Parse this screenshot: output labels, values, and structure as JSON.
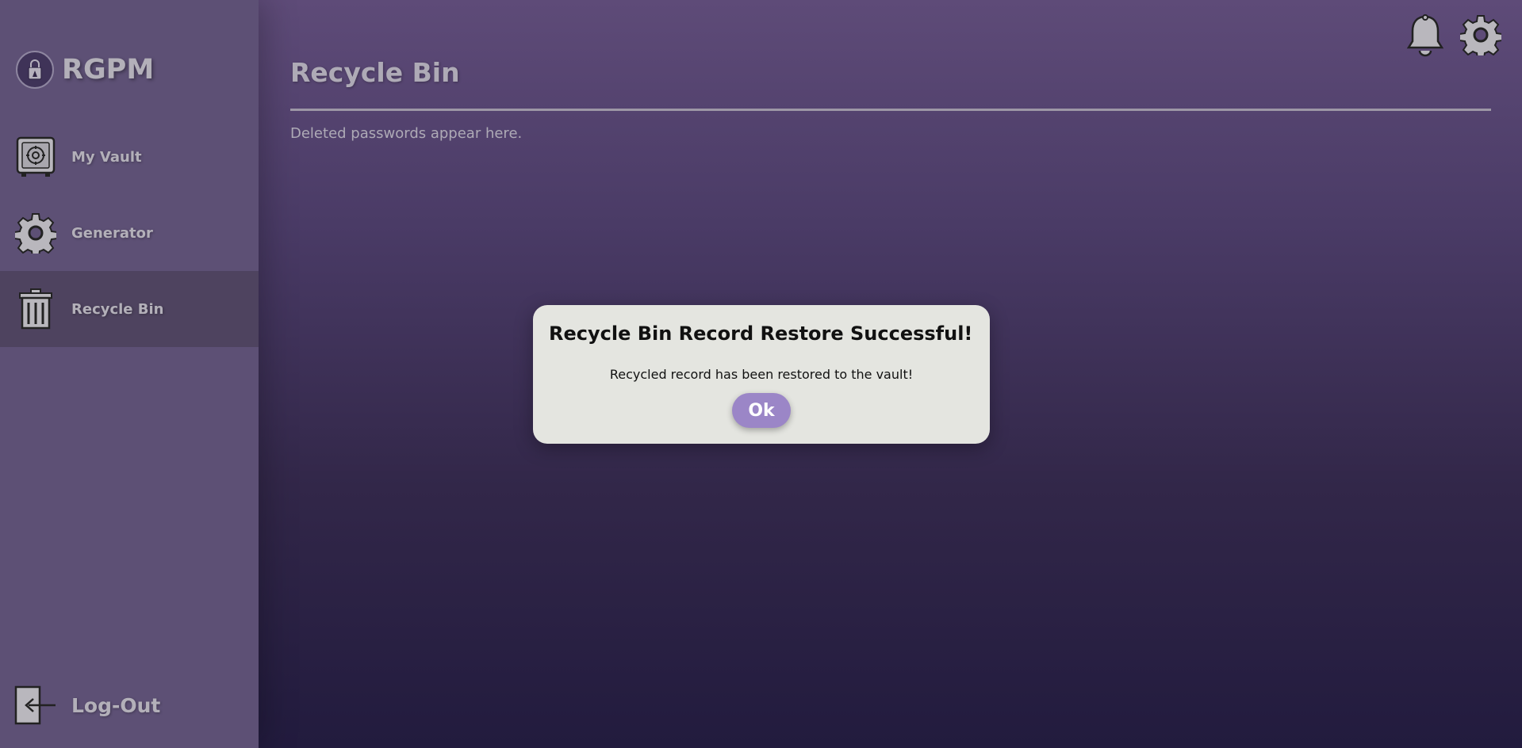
{
  "app": {
    "name": "RGPM",
    "logo_icon": "lock-logo-icon"
  },
  "sidebar": {
    "items": [
      {
        "label": "My Vault",
        "icon": "vault-safe-icon",
        "active": false
      },
      {
        "label": "Generator",
        "icon": "gear-icon",
        "active": false
      },
      {
        "label": "Recycle Bin",
        "icon": "trash-bin-icon",
        "active": true
      }
    ],
    "logout": {
      "label": "Log-Out",
      "icon": "logout-door-icon"
    }
  },
  "header": {
    "notifications_icon": "bell-icon",
    "settings_icon": "gear-icon"
  },
  "main": {
    "title": "Recycle Bin",
    "subtitle": "Deleted passwords appear here."
  },
  "dialog": {
    "title": "Recycle Bin Record Restore Successful!",
    "message": "Recycled record has been restored to the vault!",
    "ok_label": "Ok"
  },
  "colors": {
    "sidebar_bg": "#5d5075",
    "sidebar_active_bg": "#4e435f",
    "text_muted": "#b3b0b9",
    "dialog_bg": "#e4e5e0",
    "button_accent": "#9b86c7",
    "background_top": "#5e4b78",
    "background_bottom": "#221b3e"
  }
}
